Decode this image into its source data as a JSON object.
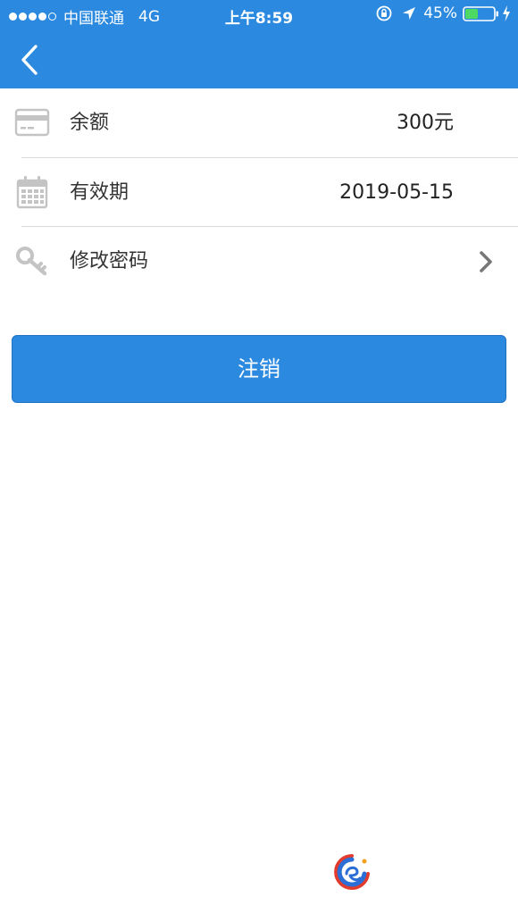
{
  "status_bar": {
    "carrier": "中国联通",
    "network": "4G",
    "time": "上午8:59",
    "battery_percent": "45%",
    "battery_level": 0.45,
    "signal_bars_filled": 4,
    "signal_bars_total": 5
  },
  "colors": {
    "accent": "#2b8ae0",
    "divider": "#dadada",
    "icon_gray": "#c4c4c4",
    "battery_green": "#4cd964"
  },
  "rows": [
    {
      "icon": "credit-card-icon",
      "label": "余额",
      "value": "300元"
    },
    {
      "icon": "calendar-icon",
      "label": "有效期",
      "value": "2019-05-15"
    },
    {
      "icon": "key-icon",
      "label": "修改密码",
      "trailing_icon": "chevron-right-icon"
    }
  ],
  "logout_label": "注销"
}
